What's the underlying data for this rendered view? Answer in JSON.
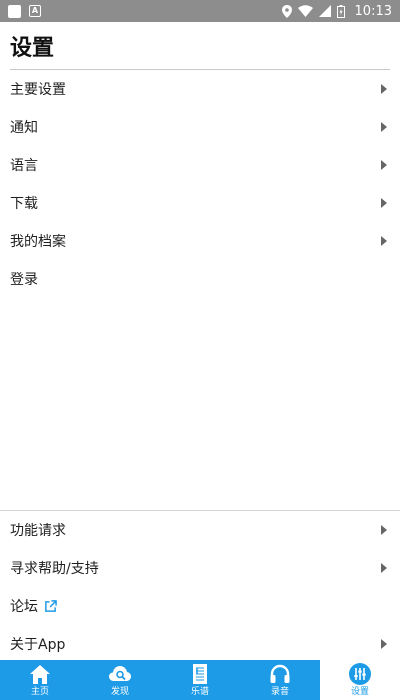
{
  "status_bar": {
    "time": "10:13",
    "left_icons": [
      "app-square-icon",
      "a-letter-icon"
    ],
    "right_icons": [
      "location-icon",
      "wifi-icon",
      "signal-icon",
      "battery-icon"
    ]
  },
  "header": {
    "title": "设置"
  },
  "menu_top": [
    {
      "label": "主要设置",
      "chevron": true
    },
    {
      "label": "通知",
      "chevron": true
    },
    {
      "label": "语言",
      "chevron": true
    },
    {
      "label": "下载",
      "chevron": true
    },
    {
      "label": "我的档案",
      "chevron": true
    },
    {
      "label": "登录",
      "chevron": false
    }
  ],
  "menu_bottom": [
    {
      "label": "功能请求",
      "chevron": true
    },
    {
      "label": "寻求帮助/支持",
      "chevron": true
    },
    {
      "label": "论坛",
      "chevron": false,
      "external_icon": "external-link-icon"
    },
    {
      "label": "关于App",
      "chevron": true
    }
  ],
  "tabs": [
    {
      "label": "主页",
      "icon": "home-icon",
      "active": false
    },
    {
      "label": "发现",
      "icon": "cloud-search-icon",
      "active": false
    },
    {
      "label": "乐谱",
      "icon": "sheet-music-icon",
      "active": false
    },
    {
      "label": "录音",
      "icon": "headphones-icon",
      "active": false
    },
    {
      "label": "设置",
      "icon": "sliders-icon",
      "active": true
    }
  ],
  "colors": {
    "accent": "#1e9be6",
    "status_bar": "#8d8d8d",
    "divider": "#c9c9c9",
    "text": "#1f1f1f"
  }
}
